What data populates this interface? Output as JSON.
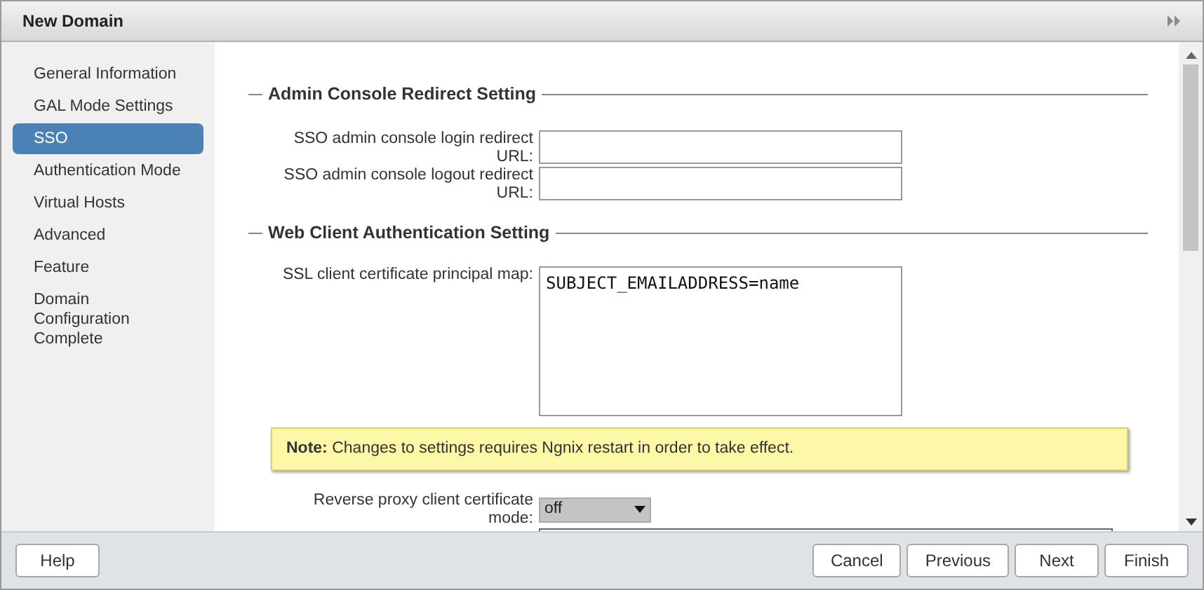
{
  "window": {
    "title": "New Domain"
  },
  "sidebar": {
    "items": [
      {
        "label": "General Information",
        "selected": false
      },
      {
        "label": "GAL Mode Settings",
        "selected": false
      },
      {
        "label": "SSO",
        "selected": true
      },
      {
        "label": "Authentication Mode",
        "selected": false
      },
      {
        "label": "Virtual Hosts",
        "selected": false
      },
      {
        "label": "Advanced",
        "selected": false
      },
      {
        "label": "Feature",
        "selected": false
      },
      {
        "label": "Domain Configuration Complete",
        "selected": false
      }
    ]
  },
  "sections": [
    {
      "title": "Admin Console Redirect Setting",
      "fields": [
        {
          "kind": "input",
          "label": "SSO admin console login redirect URL:"
        },
        {
          "kind": "input",
          "label": "SSO admin console logout redirect URL:"
        }
      ]
    },
    {
      "title": "Web Client Authentication Setting",
      "fields": [
        {
          "kind": "textarea",
          "label": "SSL client certificate principal map:",
          "value": "SUBJECT_EMAILADDRESS=name"
        },
        {
          "kind": "note",
          "label": "Note:",
          "text": "Changes to settings requires Ngnix restart in order to take effect."
        },
        {
          "kind": "select",
          "label": "Reverse proxy client certificate mode:",
          "value": "off"
        },
        {
          "kind": "partial"
        }
      ]
    }
  ],
  "buttons_left": [
    "Help"
  ],
  "buttons_right": [
    "Cancel",
    "Previous",
    "Next",
    "Finish"
  ]
}
